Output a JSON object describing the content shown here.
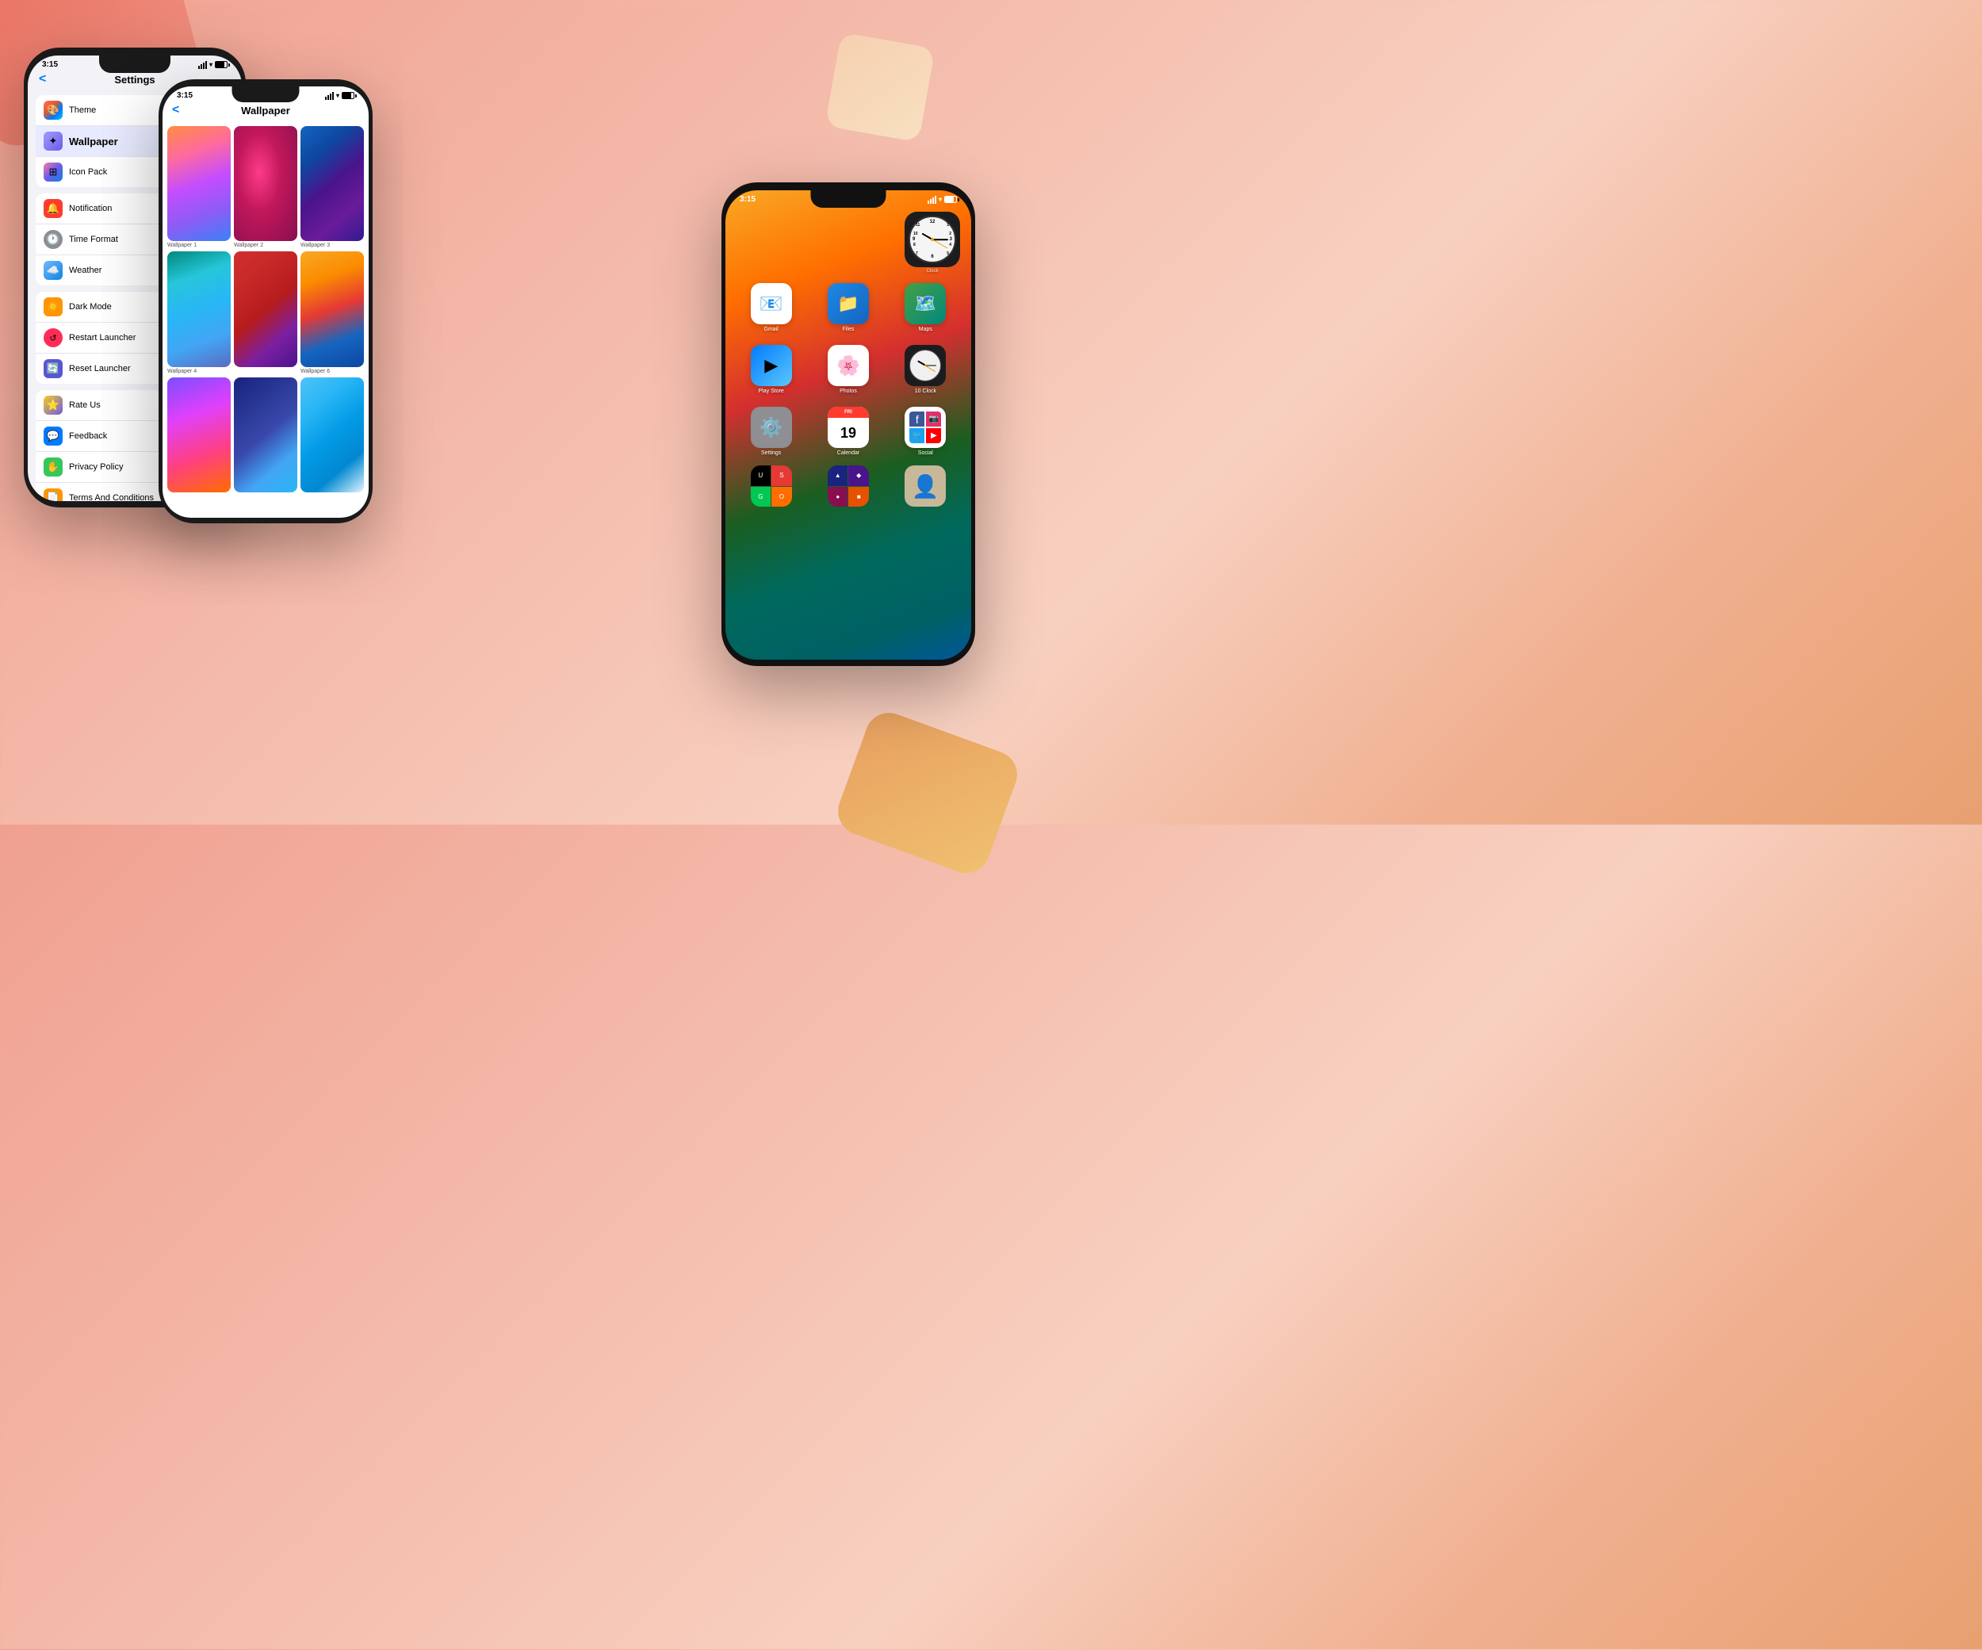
{
  "background": {
    "gradient": "linear-gradient(135deg, #f0a090, #f5c0b0, #f8d0c0, #f0b090)"
  },
  "phone_left": {
    "status_time": "3:15",
    "title": "Settings",
    "back_label": "<",
    "menu_items": [
      {
        "id": "theme",
        "label": "Theme",
        "icon": "theme"
      },
      {
        "id": "wallpaper",
        "label": "Wallpaper",
        "icon": "wallpaper",
        "active": true
      },
      {
        "id": "iconpack",
        "label": "Icon Pack",
        "icon": "iconpack"
      },
      {
        "id": "notification",
        "label": "Notification",
        "icon": "notification"
      },
      {
        "id": "timeformat",
        "label": "Time Format",
        "icon": "timeformat"
      },
      {
        "id": "weather",
        "label": "Weather",
        "icon": "weather"
      },
      {
        "id": "darkmode",
        "label": "Dark Mode",
        "icon": "darkmode"
      },
      {
        "id": "restart",
        "label": "Restart Launcher",
        "icon": "restart"
      },
      {
        "id": "reset",
        "label": "Reset Launcher",
        "icon": "reset"
      },
      {
        "id": "rateus",
        "label": "Rate Us",
        "icon": "rateus"
      },
      {
        "id": "feedback",
        "label": "Feedback",
        "icon": "feedback"
      },
      {
        "id": "privacy",
        "label": "Privacy Policy",
        "icon": "privacy"
      },
      {
        "id": "terms",
        "label": "Terms And Conditions",
        "icon": "terms"
      }
    ]
  },
  "phone_mid": {
    "status_time": "3:15",
    "title": "Wallpaper",
    "back_label": "<",
    "wallpapers": [
      {
        "id": "wp1",
        "label": "Wallpaper 1"
      },
      {
        "id": "wp2",
        "label": "Wallpaper 2"
      },
      {
        "id": "wp3",
        "label": "Wallpaper 3"
      },
      {
        "id": "wp4",
        "label": "Wallpaper 4"
      },
      {
        "id": "wp5",
        "label": ""
      },
      {
        "id": "wp6",
        "label": "Wallpaper 6"
      },
      {
        "id": "wp7",
        "label": ""
      },
      {
        "id": "wp8",
        "label": ""
      },
      {
        "id": "wp9",
        "label": ""
      }
    ]
  },
  "phone_right": {
    "apps": [
      {
        "id": "clock_widget",
        "label": "Clock",
        "type": "clock"
      },
      {
        "id": "gmail",
        "label": "Gmail",
        "type": "gmail"
      },
      {
        "id": "files",
        "label": "Files",
        "type": "files"
      },
      {
        "id": "maps",
        "label": "Maps",
        "type": "maps"
      },
      {
        "id": "playstore",
        "label": "Play Store",
        "type": "appstore"
      },
      {
        "id": "photos",
        "label": "Photos",
        "type": "photos"
      },
      {
        "id": "clock_small",
        "label": "Clock",
        "type": "clock_small"
      },
      {
        "id": "settings",
        "label": "Settings",
        "type": "settings"
      },
      {
        "id": "calendar",
        "label": "Calendar",
        "type": "calendar"
      },
      {
        "id": "social",
        "label": "Social",
        "type": "social"
      }
    ],
    "calendar_date": "19",
    "calendar_day": "FRI"
  }
}
